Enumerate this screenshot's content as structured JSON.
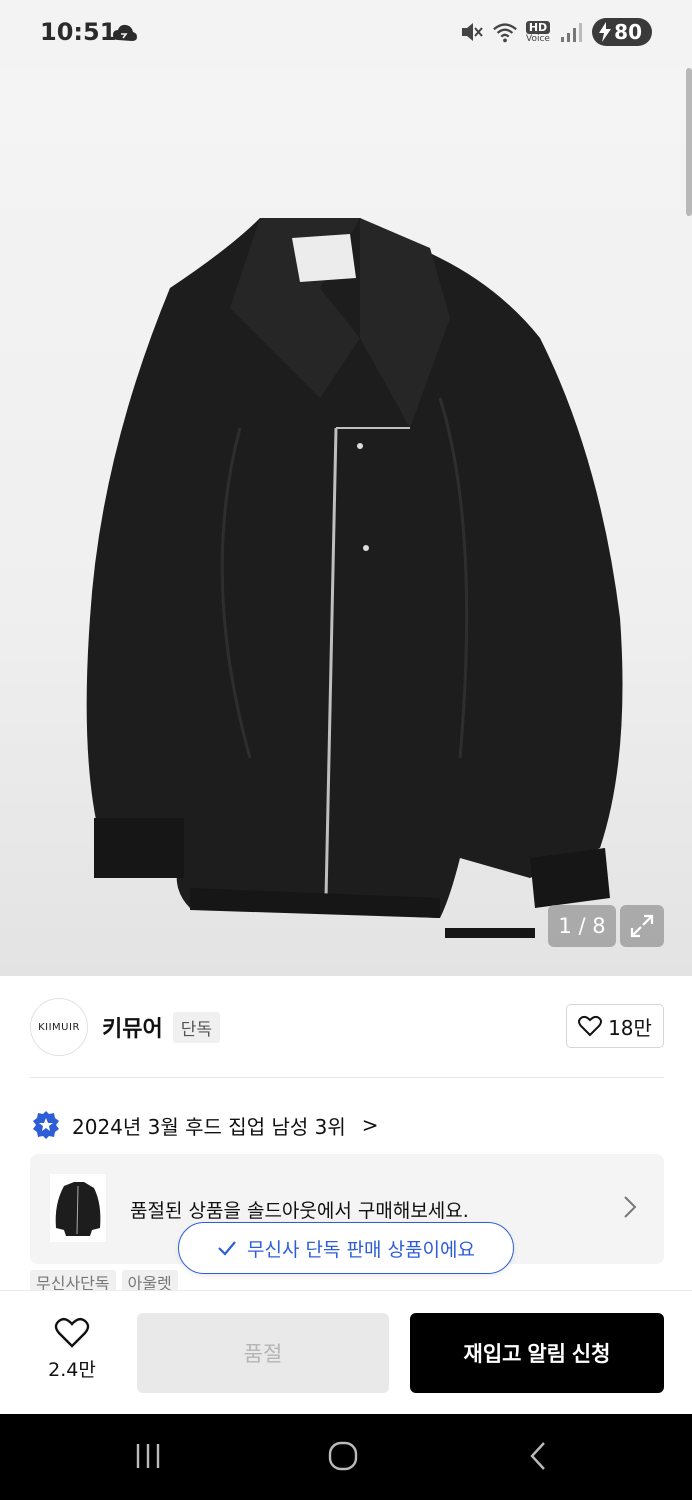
{
  "status_bar": {
    "time": "10:51",
    "battery": "80",
    "hd": "HD",
    "voice": "Voice",
    "icons": [
      "cloud-icon",
      "mute-icon",
      "wifi-icon",
      "hd-voice-icon",
      "signal-icon",
      "battery-charging-icon"
    ]
  },
  "gallery": {
    "counter": "1 / 8",
    "image_alt_logo": "KIIMUIR"
  },
  "brand": {
    "logo_text": "KIIMUIR",
    "name": "키뮤어",
    "tag": "단독",
    "likes": "18만"
  },
  "ranking": {
    "text": "2024년 3월 후드 집업 남성 3위",
    "chevron": ">"
  },
  "soldout_card": {
    "text": "품절된 상품을 솔드아웃에서 구매해보세요."
  },
  "exclusive_pill": {
    "text": "무신사 단독 판매 상품이에요"
  },
  "tags": [
    "무신사단독",
    "아울렛"
  ],
  "bottom_bar": {
    "wish_count": "2.4만",
    "soldout_label": "품절",
    "restock_label": "재입고 알림 신청"
  },
  "colors": {
    "accent_blue": "#2e5ed6",
    "primary_black": "#000000"
  }
}
